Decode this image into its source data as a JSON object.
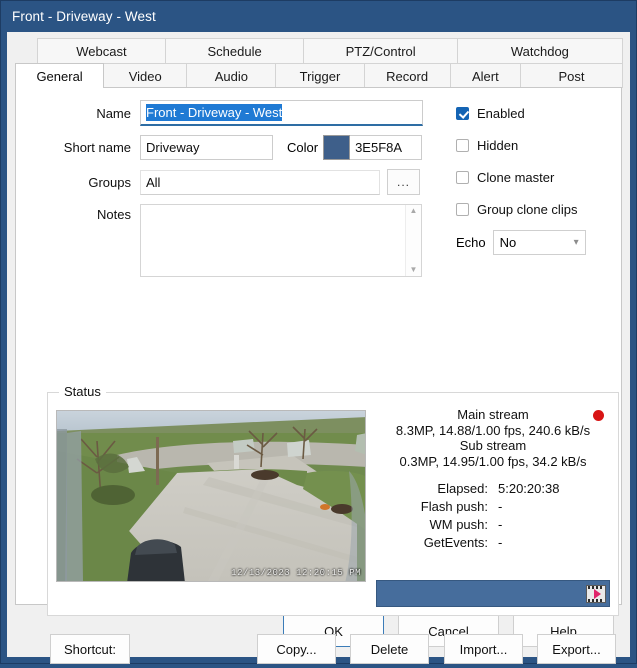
{
  "window": {
    "title": "Front - Driveway - West",
    "titlebar_color": "#2b5484"
  },
  "tabs": {
    "row1": [
      {
        "label": "Webcast",
        "active": false
      },
      {
        "label": "Schedule",
        "active": false
      },
      {
        "label": "PTZ/Control",
        "active": false
      },
      {
        "label": "Watchdog",
        "active": false
      }
    ],
    "row2": [
      {
        "label": "General",
        "active": true
      },
      {
        "label": "Video",
        "active": false
      },
      {
        "label": "Audio",
        "active": false
      },
      {
        "label": "Trigger",
        "active": false
      },
      {
        "label": "Record",
        "active": false
      },
      {
        "label": "Alert",
        "active": false
      },
      {
        "label": "Post",
        "active": false
      }
    ]
  },
  "form": {
    "name_label": "Name",
    "name_value": "Front - Driveway - West",
    "short_name_label": "Short name",
    "short_name_value": "Driveway",
    "color_label": "Color",
    "color_value": "3E5F8A",
    "color_hex": "#3E5F8A",
    "groups_label": "Groups",
    "groups_value": "All",
    "groups_browse_label": "...",
    "notes_label": "Notes",
    "notes_value": ""
  },
  "options": {
    "enabled": {
      "label": "Enabled",
      "checked": true
    },
    "hidden": {
      "label": "Hidden",
      "checked": false
    },
    "clone_master": {
      "label": "Clone master",
      "checked": false
    },
    "group_clone_clips": {
      "label": "Group clone clips",
      "checked": false
    },
    "echo_label": "Echo",
    "echo_value": "No"
  },
  "status": {
    "legend": "Status",
    "main_stream_title": "Main stream",
    "main_stream_info": "8.3MP, 14.88/1.00 fps,  240.6 kB/s",
    "sub_stream_title": "Sub stream",
    "sub_stream_info": "0.3MP, 14.95/1.00 fps,   34.2 kB/s",
    "elapsed_label": "Elapsed:",
    "elapsed_value": "5:20:20:38",
    "flash_push_label": "Flash push:",
    "flash_push_value": "-",
    "wm_push_label": "WM push:",
    "wm_push_value": "-",
    "getevents_label": "GetEvents:",
    "getevents_value": "-",
    "recording_indicator_color": "#d81414",
    "statusbar_color": "#466d9c",
    "video_timestamp": "12/13/2023 12:20:15 PM"
  },
  "actions": {
    "shortcut": "Shortcut:",
    "copy": "Copy...",
    "delete": "Delete",
    "import": "Import...",
    "export": "Export..."
  },
  "dialog_buttons": {
    "ok": "OK",
    "cancel": "Cancel",
    "help": "Help"
  }
}
